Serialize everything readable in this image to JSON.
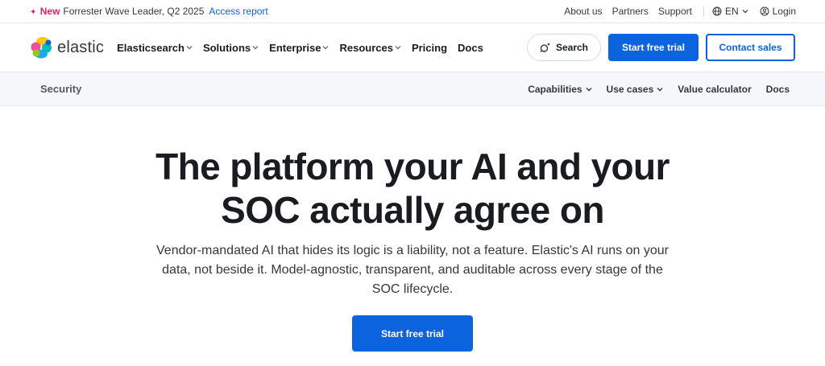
{
  "announcement": {
    "badge": "New",
    "message": "Forrester Wave Leader, Q2 2025",
    "link": "Access report"
  },
  "utility_nav": {
    "items": [
      "About us",
      "Partners",
      "Support"
    ],
    "language": "EN",
    "login": "Login"
  },
  "brand": {
    "name": "elastic",
    "colors": [
      "#fec514",
      "#f04e98",
      "#00bfb3",
      "#1ba9f5",
      "#93c90e",
      "#07c"
    ]
  },
  "main_nav": {
    "items": [
      {
        "label": "Elasticsearch",
        "dropdown": true
      },
      {
        "label": "Solutions",
        "dropdown": true
      },
      {
        "label": "Enterprise",
        "dropdown": true
      },
      {
        "label": "Resources",
        "dropdown": true
      },
      {
        "label": "Pricing",
        "dropdown": false
      },
      {
        "label": "Docs",
        "dropdown": false
      }
    ],
    "search_label": "Search",
    "trial_label": "Start free trial",
    "contact_label": "Contact sales"
  },
  "sub_nav": {
    "section": "Security",
    "items": [
      {
        "label": "Capabilities",
        "dropdown": true
      },
      {
        "label": "Use cases",
        "dropdown": true
      },
      {
        "label": "Value calculator",
        "dropdown": false
      },
      {
        "label": "Docs",
        "dropdown": false
      }
    ]
  },
  "hero": {
    "title_line1": "The platform your AI and your",
    "title_line2": "SOC actually agree on",
    "subtitle": "Vendor-mandated AI that hides its logic is a liability, not a feature. Elastic's AI runs on your data, not beside it. Model-agnostic, transparent, and auditable across every stage of the SOC lifecycle.",
    "cta_label": "Start free trial"
  },
  "colors": {
    "accent": "#0b64dd",
    "new_badge": "#e0205f",
    "subnav_bg": "#f5f7fa"
  }
}
